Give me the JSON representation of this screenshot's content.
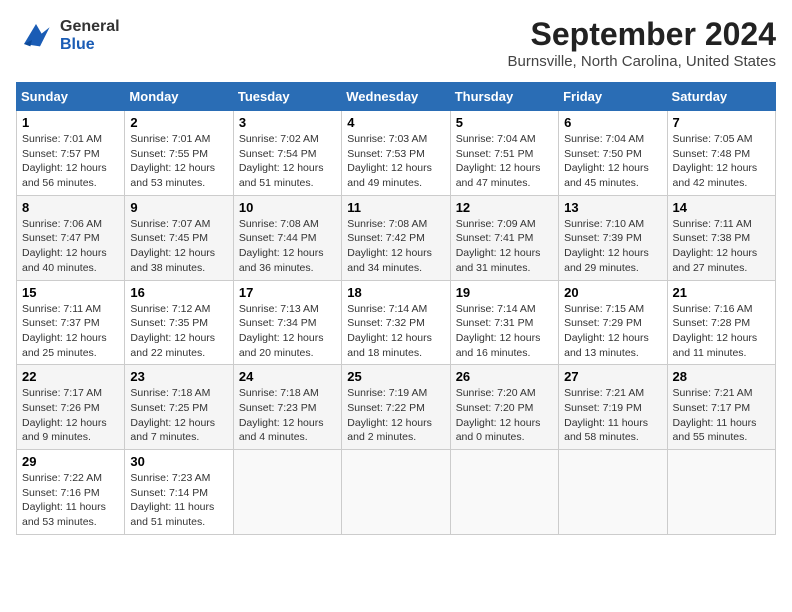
{
  "header": {
    "logo_general": "General",
    "logo_blue": "Blue",
    "title": "September 2024",
    "subtitle": "Burnsville, North Carolina, United States"
  },
  "calendar": {
    "days_of_week": [
      "Sunday",
      "Monday",
      "Tuesday",
      "Wednesday",
      "Thursday",
      "Friday",
      "Saturday"
    ],
    "weeks": [
      [
        {
          "day": "1",
          "sunrise": "7:01 AM",
          "sunset": "7:57 PM",
          "daylight": "12 hours and 56 minutes."
        },
        {
          "day": "2",
          "sunrise": "7:01 AM",
          "sunset": "7:55 PM",
          "daylight": "12 hours and 53 minutes."
        },
        {
          "day": "3",
          "sunrise": "7:02 AM",
          "sunset": "7:54 PM",
          "daylight": "12 hours and 51 minutes."
        },
        {
          "day": "4",
          "sunrise": "7:03 AM",
          "sunset": "7:53 PM",
          "daylight": "12 hours and 49 minutes."
        },
        {
          "day": "5",
          "sunrise": "7:04 AM",
          "sunset": "7:51 PM",
          "daylight": "12 hours and 47 minutes."
        },
        {
          "day": "6",
          "sunrise": "7:04 AM",
          "sunset": "7:50 PM",
          "daylight": "12 hours and 45 minutes."
        },
        {
          "day": "7",
          "sunrise": "7:05 AM",
          "sunset": "7:48 PM",
          "daylight": "12 hours and 42 minutes."
        }
      ],
      [
        {
          "day": "8",
          "sunrise": "7:06 AM",
          "sunset": "7:47 PM",
          "daylight": "12 hours and 40 minutes."
        },
        {
          "day": "9",
          "sunrise": "7:07 AM",
          "sunset": "7:45 PM",
          "daylight": "12 hours and 38 minutes."
        },
        {
          "day": "10",
          "sunrise": "7:08 AM",
          "sunset": "7:44 PM",
          "daylight": "12 hours and 36 minutes."
        },
        {
          "day": "11",
          "sunrise": "7:08 AM",
          "sunset": "7:42 PM",
          "daylight": "12 hours and 34 minutes."
        },
        {
          "day": "12",
          "sunrise": "7:09 AM",
          "sunset": "7:41 PM",
          "daylight": "12 hours and 31 minutes."
        },
        {
          "day": "13",
          "sunrise": "7:10 AM",
          "sunset": "7:39 PM",
          "daylight": "12 hours and 29 minutes."
        },
        {
          "day": "14",
          "sunrise": "7:11 AM",
          "sunset": "7:38 PM",
          "daylight": "12 hours and 27 minutes."
        }
      ],
      [
        {
          "day": "15",
          "sunrise": "7:11 AM",
          "sunset": "7:37 PM",
          "daylight": "12 hours and 25 minutes."
        },
        {
          "day": "16",
          "sunrise": "7:12 AM",
          "sunset": "7:35 PM",
          "daylight": "12 hours and 22 minutes."
        },
        {
          "day": "17",
          "sunrise": "7:13 AM",
          "sunset": "7:34 PM",
          "daylight": "12 hours and 20 minutes."
        },
        {
          "day": "18",
          "sunrise": "7:14 AM",
          "sunset": "7:32 PM",
          "daylight": "12 hours and 18 minutes."
        },
        {
          "day": "19",
          "sunrise": "7:14 AM",
          "sunset": "7:31 PM",
          "daylight": "12 hours and 16 minutes."
        },
        {
          "day": "20",
          "sunrise": "7:15 AM",
          "sunset": "7:29 PM",
          "daylight": "12 hours and 13 minutes."
        },
        {
          "day": "21",
          "sunrise": "7:16 AM",
          "sunset": "7:28 PM",
          "daylight": "12 hours and 11 minutes."
        }
      ],
      [
        {
          "day": "22",
          "sunrise": "7:17 AM",
          "sunset": "7:26 PM",
          "daylight": "12 hours and 9 minutes."
        },
        {
          "day": "23",
          "sunrise": "7:18 AM",
          "sunset": "7:25 PM",
          "daylight": "12 hours and 7 minutes."
        },
        {
          "day": "24",
          "sunrise": "7:18 AM",
          "sunset": "7:23 PM",
          "daylight": "12 hours and 4 minutes."
        },
        {
          "day": "25",
          "sunrise": "7:19 AM",
          "sunset": "7:22 PM",
          "daylight": "12 hours and 2 minutes."
        },
        {
          "day": "26",
          "sunrise": "7:20 AM",
          "sunset": "7:20 PM",
          "daylight": "12 hours and 0 minutes."
        },
        {
          "day": "27",
          "sunrise": "7:21 AM",
          "sunset": "7:19 PM",
          "daylight": "11 hours and 58 minutes."
        },
        {
          "day": "28",
          "sunrise": "7:21 AM",
          "sunset": "7:17 PM",
          "daylight": "11 hours and 55 minutes."
        }
      ],
      [
        {
          "day": "29",
          "sunrise": "7:22 AM",
          "sunset": "7:16 PM",
          "daylight": "11 hours and 53 minutes."
        },
        {
          "day": "30",
          "sunrise": "7:23 AM",
          "sunset": "7:14 PM",
          "daylight": "11 hours and 51 minutes."
        },
        null,
        null,
        null,
        null,
        null
      ]
    ]
  }
}
